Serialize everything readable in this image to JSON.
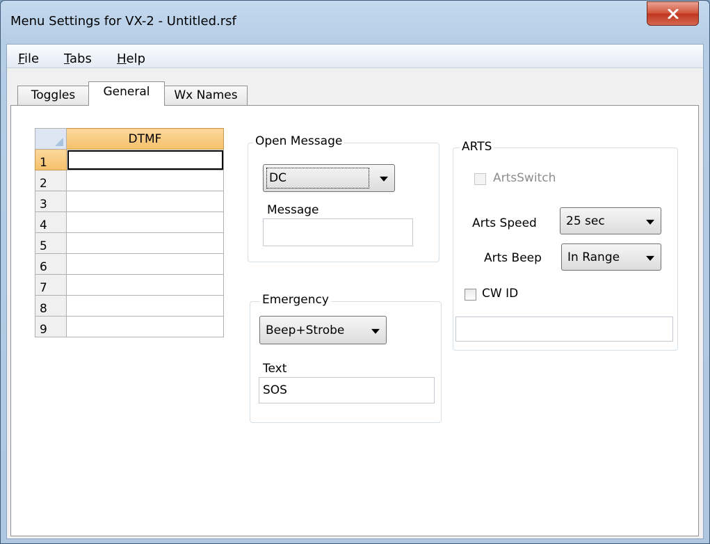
{
  "window": {
    "title": "Menu Settings for VX-2 - Untitled.rsf",
    "close_icon": "close-icon"
  },
  "menu": [
    {
      "label": "File",
      "accel": "F",
      "rest": "ile"
    },
    {
      "label": "Tabs",
      "accel": "T",
      "rest": "abs"
    },
    {
      "label": "Help",
      "accel": "H",
      "rest": "elp"
    }
  ],
  "tabs": [
    {
      "label": "Toggles",
      "active": false
    },
    {
      "label": "General",
      "active": true
    },
    {
      "label": "Wx Names",
      "active": false
    }
  ],
  "dtmf_grid": {
    "column_header": "DTMF",
    "rows": [
      "1",
      "2",
      "3",
      "4",
      "5",
      "6",
      "7",
      "8",
      "9"
    ],
    "values": [
      "",
      "",
      "",
      "",
      "",
      "",
      "",
      "",
      ""
    ],
    "selected_row": "1"
  },
  "open_message": {
    "group_label": "Open Message",
    "select_value": "DC",
    "message_label": "Message",
    "message_value": ""
  },
  "emergency": {
    "group_label": "Emergency",
    "select_value": "Beep+Strobe",
    "text_label": "Text",
    "text_value": "SOS"
  },
  "arts": {
    "group_label": "ARTS",
    "switch_label": "ArtsSwitch",
    "switch_checked": false,
    "switch_enabled": false,
    "speed_label": "Arts Speed",
    "speed_value": "25 sec",
    "beep_label": "Arts Beep",
    "beep_value": "In Range",
    "cwid_label": "CW ID",
    "cwid_checked": false,
    "cwid_value": ""
  },
  "colors": {
    "selection_header": "#f6c06a",
    "close_button": "#c0361f"
  }
}
